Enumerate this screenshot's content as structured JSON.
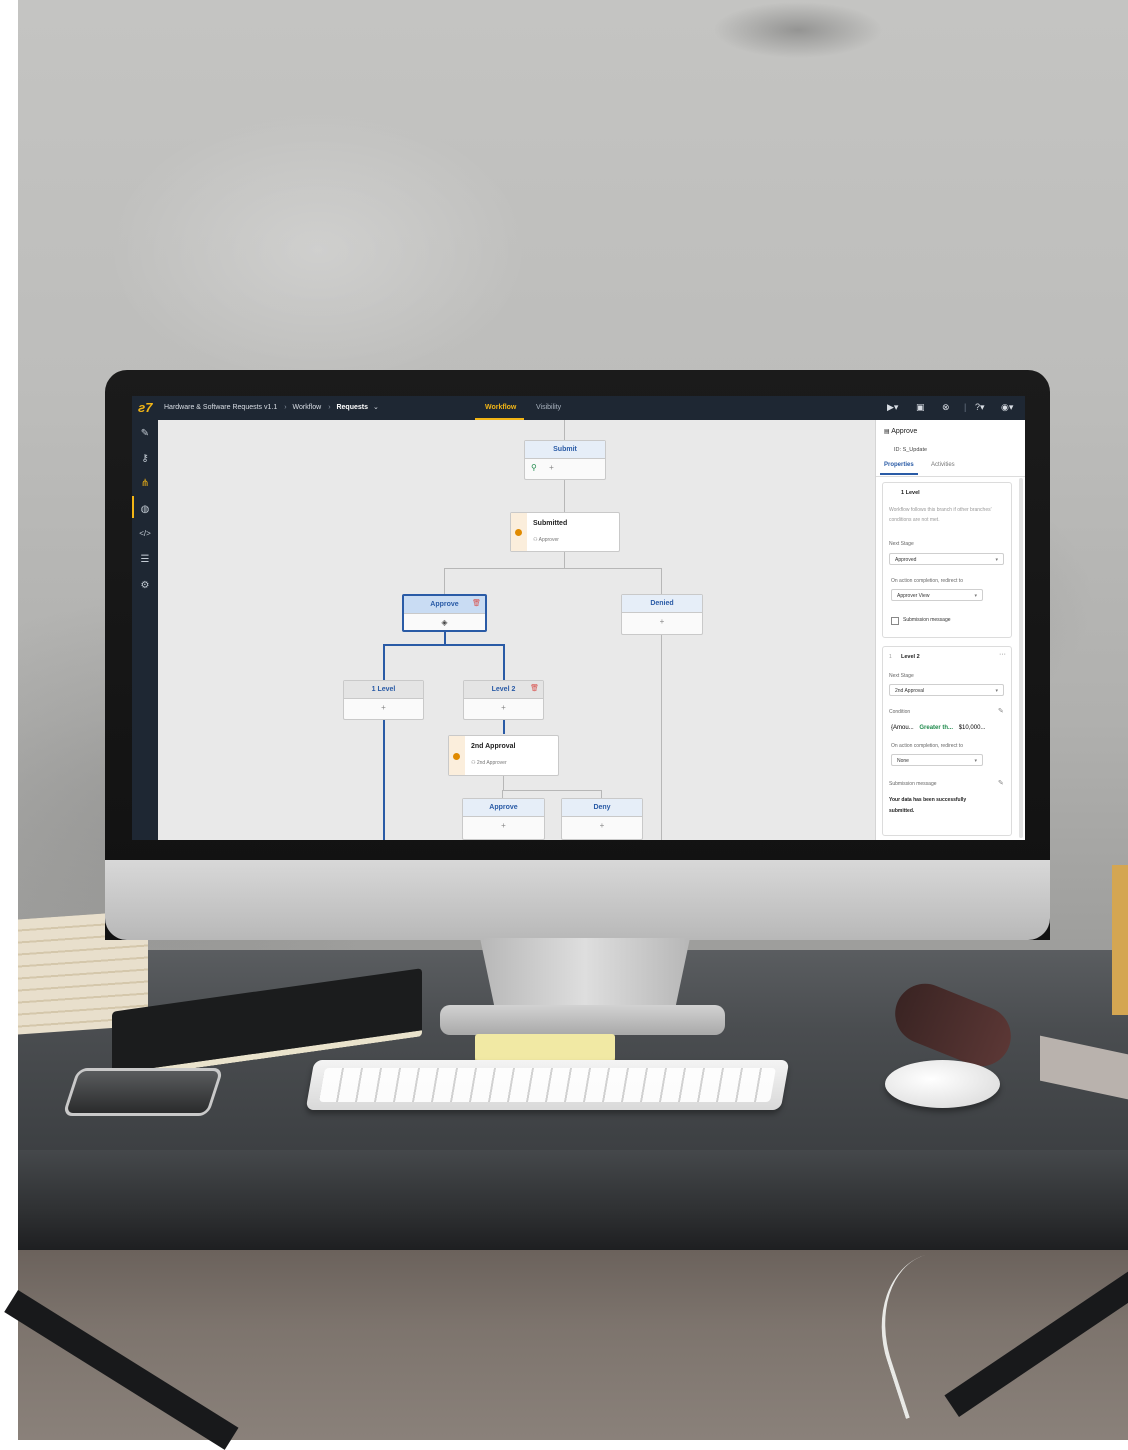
{
  "app": {
    "breadcrumb": [
      "Hardware & Software Requests v1.1",
      "Workflow",
      "Requests"
    ],
    "breadcrumb_caret": "⌄",
    "tabs": [
      "Workflow",
      "Visibility"
    ],
    "toolbar_icons": [
      "play-icon",
      "save-icon",
      "cancel-icon",
      "help-icon",
      "user-icon"
    ]
  },
  "sidebar_icons": [
    "brush-icon",
    "key-icon",
    "workflow-icon",
    "palette-icon",
    "code-icon",
    "list-alert-icon",
    "settings-icon"
  ],
  "canvas": {
    "nodes": {
      "submit": {
        "title": "Submit",
        "body": "+"
      },
      "submitted": {
        "title": "Submitted",
        "sub": "Approver"
      },
      "approve": {
        "title": "Approve",
        "body": "◈"
      },
      "denied": {
        "title": "Denied",
        "body": "+"
      },
      "level1": {
        "title": "1 Level",
        "body": "+"
      },
      "level2": {
        "title": "Level 2",
        "body": "+"
      },
      "approval2": {
        "title": "2nd Approval",
        "sub": "2nd Approver"
      },
      "approve2": {
        "title": "Approve",
        "body": "+"
      },
      "deny": {
        "title": "Deny",
        "body": "+"
      }
    }
  },
  "panel": {
    "title": "Approve",
    "id_label": "ID:",
    "id_value": "S_Update",
    "tabs": [
      "Properties",
      "Activities"
    ],
    "card1": {
      "title": "1 Level",
      "description": "Workflow follows this branch if other branches' conditions are not met.",
      "next_stage_label": "Next Stage",
      "next_stage_value": "Approved",
      "redirect_label": "On action completion, redirect to",
      "redirect_value": "Approver View",
      "submission_label": "Submission message"
    },
    "card2": {
      "index": "1",
      "title": "Level 2",
      "next_stage_label": "Next Stage",
      "next_stage_value": "2nd Approval",
      "condition_label": "Condition",
      "condition_field": "{Amou...",
      "condition_op": "Greater th...",
      "condition_value": "$10,000...",
      "redirect_label": "On action completion, redirect to",
      "redirect_value": "None",
      "submission_label": "Submission message",
      "submission_text": "Your data has been successfully submitted."
    }
  }
}
